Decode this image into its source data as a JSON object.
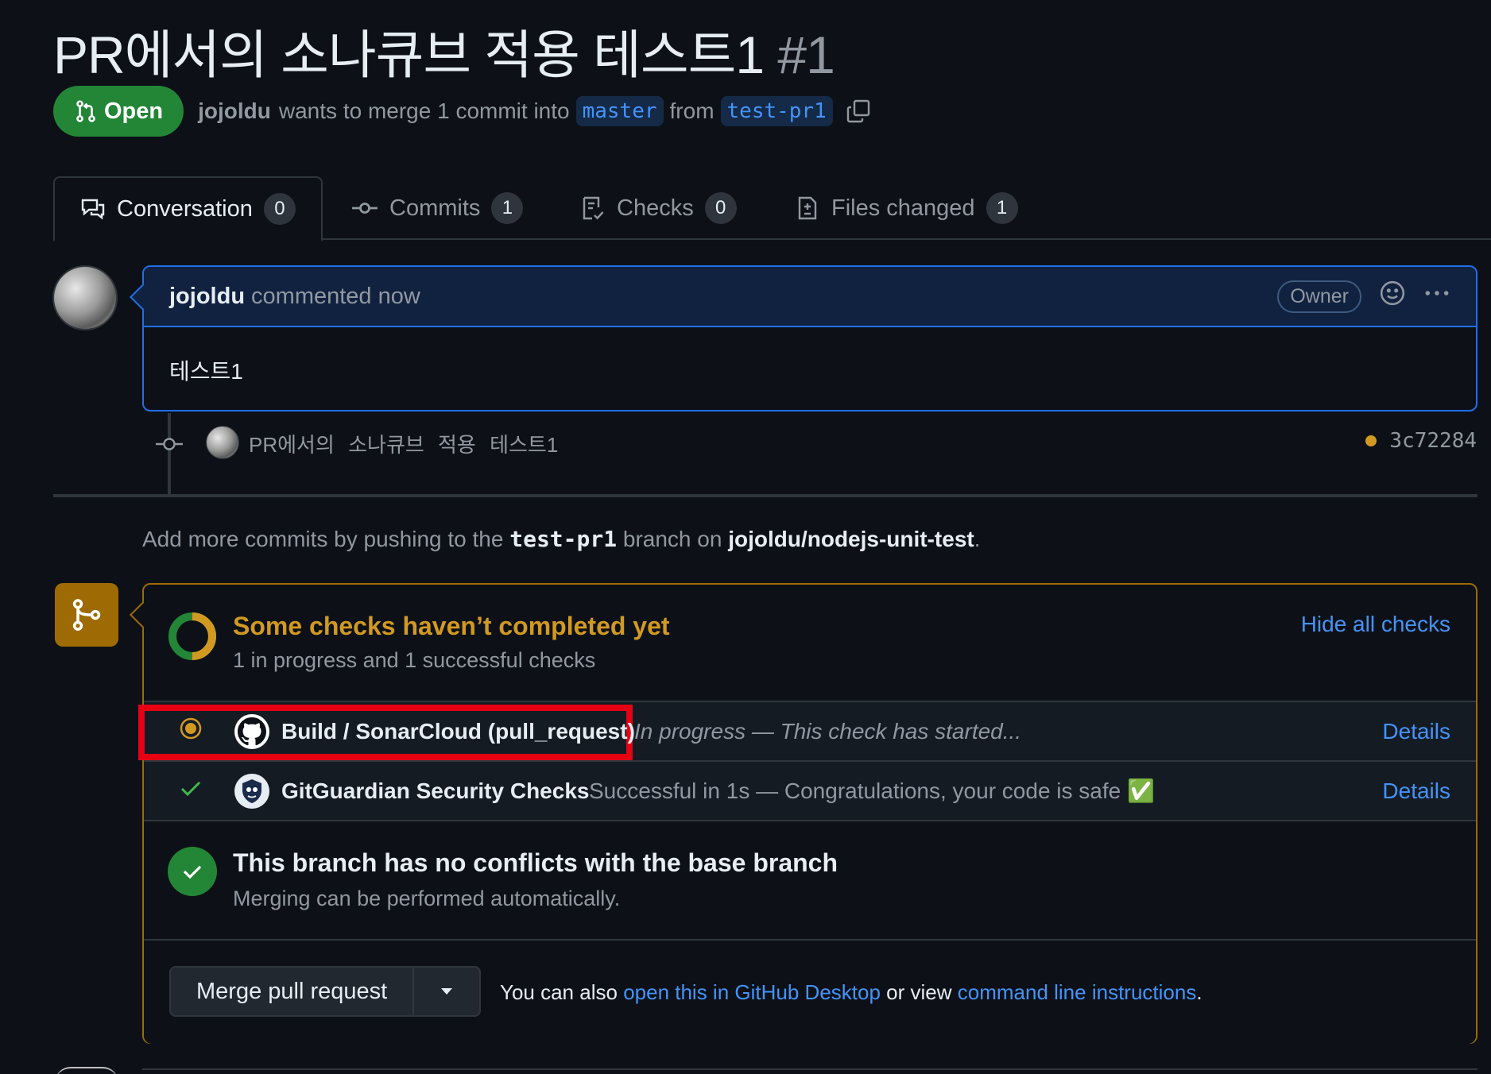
{
  "pr": {
    "title": "PR에서의 소나큐브 적용 테스트1",
    "number": "#1",
    "state": "Open",
    "author": "jojoldu",
    "merge_text": "wants to merge 1 commit into",
    "base_branch": "master",
    "from_text": "from",
    "head_branch": "test-pr1"
  },
  "tabs": [
    {
      "label": "Conversation",
      "count": "0"
    },
    {
      "label": "Commits",
      "count": "1"
    },
    {
      "label": "Checks",
      "count": "0"
    },
    {
      "label": "Files changed",
      "count": "1"
    }
  ],
  "comment": {
    "author": "jojoldu",
    "time": "commented now",
    "badge": "Owner",
    "body": "테스트1"
  },
  "commit": {
    "message": "PR에서의 소나큐브 적용 테스트1",
    "sha": "3c72284"
  },
  "push_hint": {
    "prefix": "Add more commits by pushing to the",
    "branch": "test-pr1",
    "middle": "branch on",
    "repo": "jojoldu/nodejs-unit-test",
    "suffix": "."
  },
  "checks": {
    "title": "Some checks haven’t completed yet",
    "subtitle": "1 in progress and 1 successful checks",
    "hide_label": "Hide all checks",
    "items": [
      {
        "name": "Build / SonarCloud (pull_request)",
        "description": "In progress — This check has started...",
        "details": "Details",
        "status": "in_progress",
        "app_icon": "github-icon"
      },
      {
        "name": "GitGuardian Security Checks",
        "description": "Successful in 1s — Congratulations, your code is safe ✅",
        "details": "Details",
        "status": "success",
        "app_icon": "gitguardian-icon"
      }
    ]
  },
  "conflicts": {
    "title": "This branch has no conflicts with the base branch",
    "subtitle": "Merging can be performed automatically."
  },
  "merge": {
    "button_label": "Merge pull request",
    "hint_prefix": "You can also",
    "hint_link1": "open this in GitHub Desktop",
    "hint_middle": "or view",
    "hint_link2": "command line instructions",
    "hint_suffix": "."
  },
  "colors": {
    "background": "#0d1117",
    "open_green": "#238636",
    "pending_yellow": "#d29922",
    "link_blue": "#4493f8",
    "highlight_red": "#e60012"
  }
}
